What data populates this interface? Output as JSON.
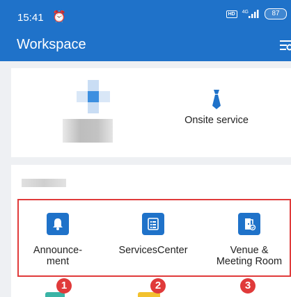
{
  "status_bar": {
    "time": "15:41",
    "network": "4G",
    "battery": "87"
  },
  "app_bar": {
    "title": "Workspace"
  },
  "top_card": {
    "items": [
      {
        "label": "Onsite service",
        "icon": "tie-icon"
      }
    ]
  },
  "services": [
    {
      "label": "Announce-\nment",
      "icon": "bell-icon"
    },
    {
      "label": "ServicesCenter",
      "icon": "checklist-icon"
    },
    {
      "label": "Venue &\nMeeting Room",
      "icon": "door-icon"
    }
  ],
  "annotations": {
    "badges": [
      "1",
      "2",
      "3"
    ],
    "highlight_color": "#e03a3a"
  },
  "colors": {
    "primary": "#1f72c9",
    "background": "#eef0f3",
    "peek_teal": "#3bb4a6",
    "peek_yellow": "#f2c12e"
  }
}
